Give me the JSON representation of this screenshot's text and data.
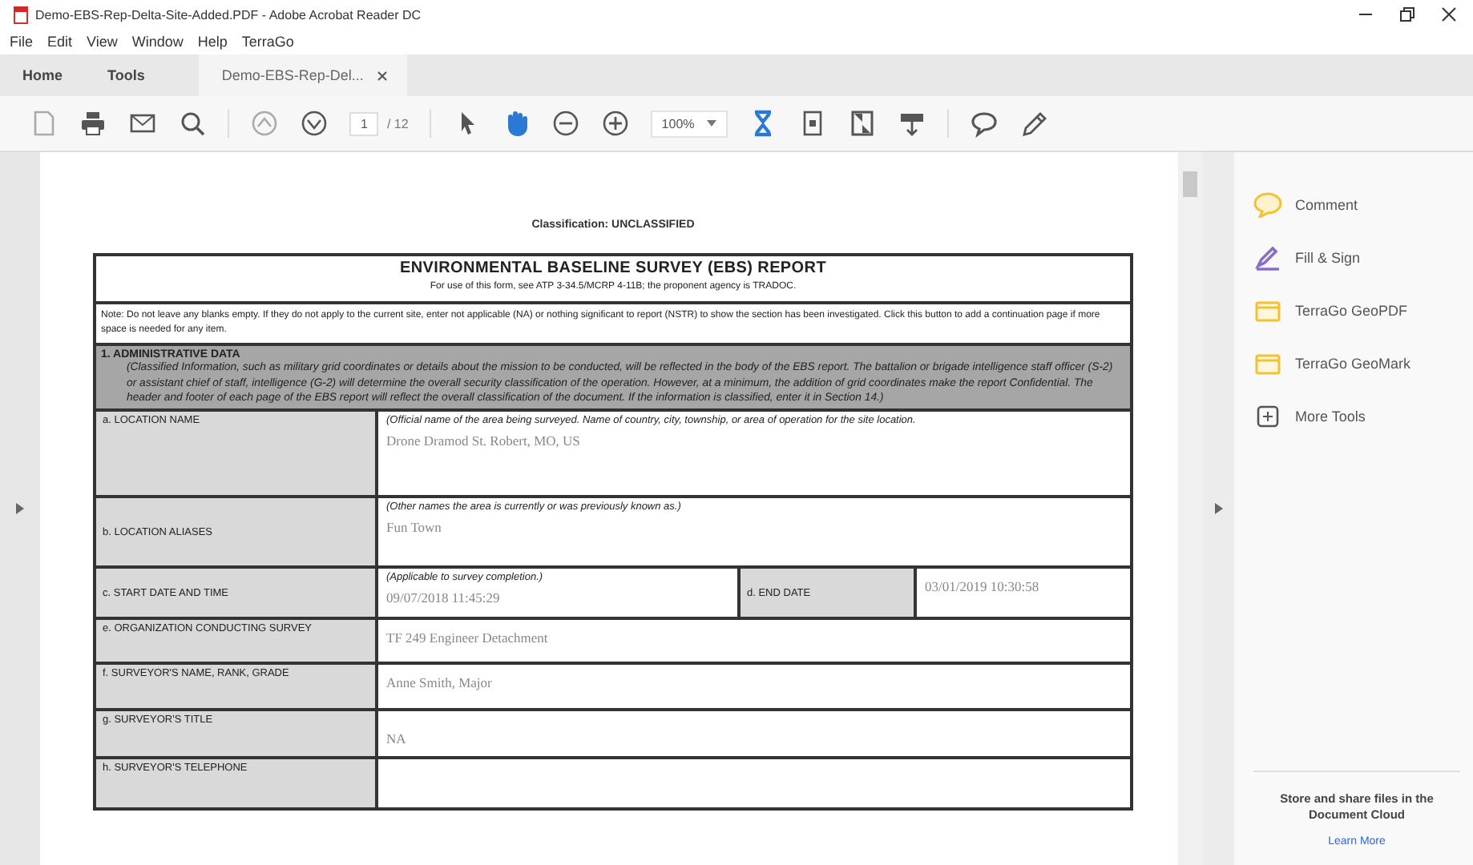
{
  "window": {
    "title": "Demo-EBS-Rep-Delta-Site-Added.PDF - Adobe Acrobat Reader DC"
  },
  "menu": [
    "File",
    "Edit",
    "View",
    "Window",
    "Help",
    "TerraGo"
  ],
  "tabs": [
    {
      "label": "Home",
      "selected": false,
      "closable": false
    },
    {
      "label": "Tools",
      "selected": false,
      "closable": false
    },
    {
      "label": "Demo-EBS-Rep-Del...",
      "selected": true,
      "closable": true
    }
  ],
  "toolbar": {
    "tools_left": [
      {
        "kind": "save",
        "active": false
      },
      {
        "kind": "print",
        "active": false
      },
      {
        "kind": "mail",
        "active": false
      },
      {
        "kind": "search",
        "active": false
      }
    ],
    "page_nav": [
      {
        "kind": "up",
        "active": false
      },
      {
        "kind": "down",
        "active": false
      }
    ],
    "page": "1",
    "page_total": "/ 12",
    "tools_mid": [
      {
        "kind": "pointer",
        "active": false
      },
      {
        "kind": "hand",
        "active": true
      },
      {
        "kind": "zoom-out",
        "active": false
      },
      {
        "kind": "zoom-in",
        "active": false
      }
    ],
    "zoom": "100%",
    "tools_right": [
      {
        "kind": "fit",
        "active": true
      },
      {
        "kind": "page",
        "active": false
      },
      {
        "kind": "fullscreen",
        "active": false
      },
      {
        "kind": "scroll",
        "active": false
      }
    ],
    "tools_end": [
      {
        "kind": "comment",
        "active": false
      },
      {
        "kind": "pen",
        "active": false
      }
    ]
  },
  "document": {
    "classification": "Classification:  UNCLASSIFIED",
    "title": "ENVIRONMENTAL BASELINE SURVEY (EBS) REPORT",
    "subtitle": "For use of this form, see ATP 3-34.5/MCRP 4-11B; the proponent agency is TRADOC.",
    "note": "Note:  Do not leave any blanks empty.  If they do not apply to the current site, enter not applicable (NA) or nothing significant to report (NSTR) to show the section has been investigated. Click this button to add a continuation page if more space is needed for any item.",
    "section": {
      "heading": "1.   ADMINISTRATIVE DATA",
      "text": "(Classified Information, such as military grid coordinates or details about the mission to be conducted, will be reflected in the body of the EBS report. The battalion or brigade intelligence staff officer (S-2) or assistant chief of staff, intelligence (G-2) will determine the overall security classification of the operation. However, at a minimum, the addition of grid coordinates make the report Confidential. The header and footer of each page of the EBS report will reflect the overall classification of the document.  If the information is classified, enter it in Section 14.)"
    },
    "rows": [
      {
        "kind": "single",
        "label": "a.  LOCATION NAME",
        "hint": "(Official name of the area being surveyed.  Name of country, city, township, or area of operation for the site location.",
        "value": "Drone Dramod    St. Robert, MO, US"
      },
      {
        "kind": "single",
        "label": "b.  LOCATION ALIASES",
        "hint": "(Other names the area is currently or was previously known as.)",
        "value": "Fun Town"
      },
      {
        "kind": "split",
        "label": "c.  START DATE AND TIME",
        "hint": "(Applicable to survey completion.)",
        "value": "09/07/2018 11:45:29",
        "label2": "d.  END DATE",
        "value2": "03/01/2019 10:30:58"
      },
      {
        "kind": "single",
        "label": "e.  ORGANIZATION CONDUCTING SURVEY",
        "value": "TF 249 Engineer Detachment"
      },
      {
        "kind": "single",
        "label": "f.  SURVEYOR'S NAME, RANK, GRADE",
        "value": "Anne Smith, Major"
      },
      {
        "kind": "single",
        "label": "g.  SURVEYOR'S TITLE",
        "value": "NA"
      },
      {
        "kind": "single",
        "label": "h.  SURVEYOR'S TELEPHONE"
      }
    ]
  },
  "tools_panel": {
    "items": [
      {
        "kind": "comment",
        "label": "Comment"
      },
      {
        "kind": "sign",
        "label": "Fill & Sign"
      },
      {
        "kind": "folder",
        "label": "TerraGo GeoPDF"
      },
      {
        "kind": "folder",
        "label": "TerraGo GeoMark"
      },
      {
        "kind": "more",
        "label": "More Tools"
      }
    ],
    "promo": "Store and share files in the Document Cloud",
    "link": "Learn More"
  }
}
